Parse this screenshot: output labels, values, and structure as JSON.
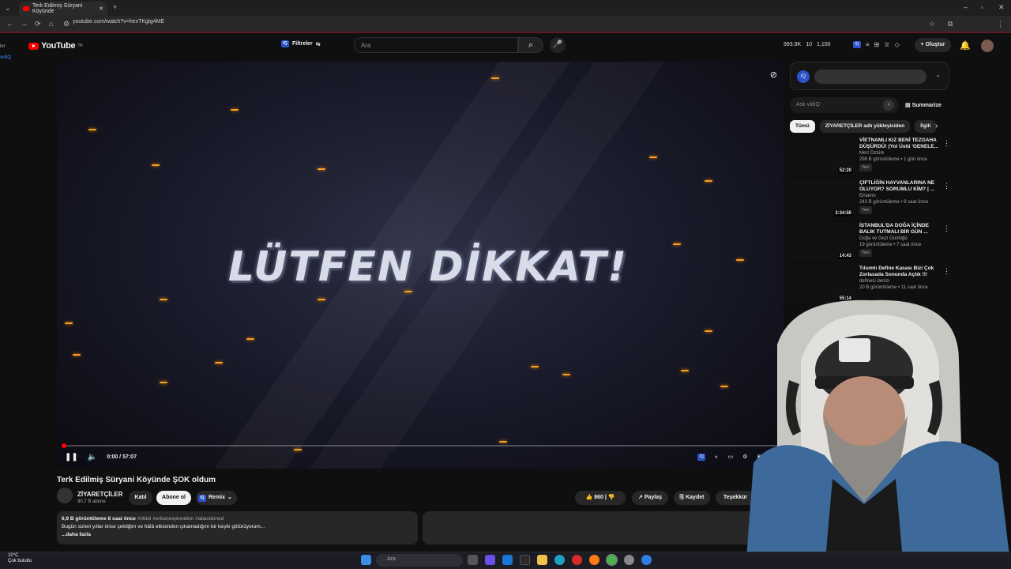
{
  "browser": {
    "tab_title": "Terk Edilmiş Süryani Köyünde",
    "url": "youtube.com/watch?v=hexTKgtg4ME"
  },
  "youtube": {
    "logo": "YouTube",
    "region": "TR",
    "filter_label": "Filtreler",
    "search_placeholder": "Ara",
    "stats": [
      "993.9K",
      "10",
      "1,150"
    ],
    "create_label": "Oluştur"
  },
  "video": {
    "overlay_text": "LÜTFEN DİKKAT!",
    "time": "0:00 / 57:07",
    "progress": 0.0,
    "title": "Terk Edilmiş Süryani Köyünde ŞOK oldum",
    "channel": "ZİYARETÇİLER",
    "subscribers": "90,7 B abone",
    "join_label": "Katıl",
    "subscribe_label": "Abone ol",
    "remix_label": "Remix",
    "likes": "860",
    "share_label": "Paylaş",
    "save_label": "Kaydet",
    "thanks_label": "Teşekkür",
    "views_date": "6,9 B görüntüleme  8 saat önce",
    "hashtags": "#ritüel #urbanexploration #abandoned",
    "description": "Bugün sizleri yıllar önce çektiğim ve hâlâ etkisinden çıkamadığım bir keşfe götürüyorum...",
    "more_label": "...daha fazla"
  },
  "sidebar": {
    "ask_placeholder": "Ask vidIQ",
    "summarize_label": "Summarize",
    "chips": [
      "Tümü",
      "ZİYARETÇİLER adlı yükleyiciden",
      "İlgili"
    ],
    "recommendations": [
      {
        "title": "VİETNAMLI KIZ BENİ TEZGAHA DÜŞÜRDÜ! (Yol Üstü 'GENELE...",
        "channel": "Mert Öztürk",
        "meta": "298 B görüntüleme • 1 gün önce",
        "badge": "Yeni",
        "duration": "52:20"
      },
      {
        "title": "ÇİFTLİĞİN HAYVANLARINA NE OLUYOR? SORUMLU KİM? | ...",
        "channel": "Elraenn",
        "meta": "243 B görüntüleme • 9 saat önce",
        "badge": "Yeni",
        "duration": "2:34:50"
      },
      {
        "title": "İSTANBUL'DA DOĞA İÇİNDE BALIK TUTMALI BİR GÜN ...",
        "channel": "Doğa ve Gezi Günlüğü",
        "meta": "19 görüntüleme • 7 saat önce",
        "badge": "Yeni",
        "duration": "14:43"
      },
      {
        "title": "Tılsımlı Define Kasası Bizi Çok Zorlasada Sonunda Açtık !!!",
        "channel": "defineci denizi",
        "meta": "20 B görüntüleme • 11 saat önce",
        "badge": "",
        "duration": "55:14"
      }
    ]
  },
  "taskbar": {
    "temp": "10°C",
    "weather": "Çok bulutlu",
    "search_placeholder": "Ara"
  }
}
